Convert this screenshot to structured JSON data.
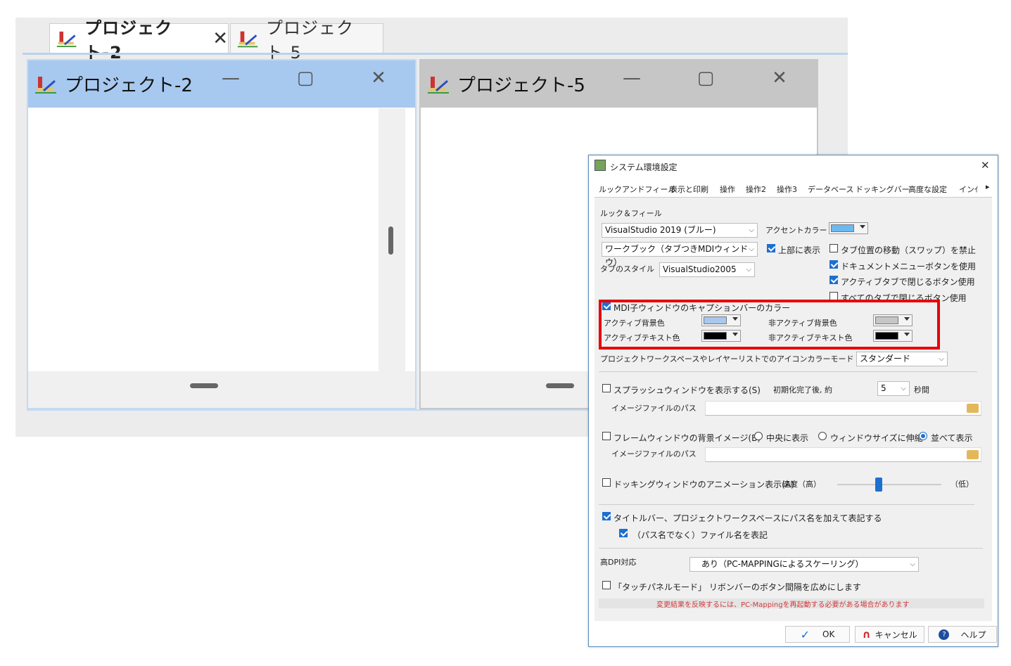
{
  "tabs": [
    {
      "label": "プロジェクト-2",
      "close": "✕"
    },
    {
      "label": "プロジェクト-5"
    }
  ],
  "windows": [
    {
      "title": "プロジェクト-2"
    },
    {
      "title": "プロジェクト-5"
    }
  ],
  "caption_buttons": {
    "minimize": "—",
    "maximize": "▢",
    "close": "✕"
  },
  "dialog": {
    "title": "システム環境設定",
    "close": "✕",
    "tabs": [
      "ルックアンドフィール",
      "表示と印刷",
      "操作",
      "操作2",
      "操作3",
      "データベース",
      "ドッキングバー",
      "高度な設定",
      "インｲ"
    ],
    "tab_scroll": "▸",
    "look": {
      "group_label": "ルック＆フィール",
      "theme": "VisualStudio 2019 (ブルー)",
      "workbook": "ワークブック（タブつきMDIウィンドウ）",
      "tab_style_label": "タブのスタイル",
      "tab_style": "VisualStudio2005",
      "accent_label": "アクセントカラー",
      "accent_color": "#6cb8f0",
      "top_show": "上部に表示",
      "no_tab_move": "タブ位置の移動（スワップ）を禁止",
      "doc_menu_btn": "ドキュメントメニューボタンを使用",
      "active_close_btn": "アクティブタブで閉じるボタン使用",
      "all_close_btn": "すべてのタブで閉じるボタン使用"
    },
    "mdi_caption": {
      "label": "MDI子ウィンドウのキャプションバーのカラー",
      "active_bg_label": "アクティブ背景色",
      "active_bg": "#a7c8ef",
      "active_text_label": "アクティブテキスト色",
      "active_text": "#000000",
      "inactive_bg_label": "非アクティブ背景色",
      "inactive_bg": "#c6c6c6",
      "inactive_text_label": "非アクティブテキスト色",
      "inactive_text": "#000000"
    },
    "icon_mode": {
      "label": "プロジェクトワークスペースやレイヤーリストでのアイコンカラーモード",
      "value": "スタンダード"
    },
    "splash": {
      "label": "スプラッシュウィンドウを表示する(S)",
      "init_label": "初期化完了後, 約",
      "seconds": "5",
      "seconds_unit": "秒間",
      "path_label": "イメージファイルのパス",
      "path": ""
    },
    "frame_bg": {
      "label": "フレームウィンドウの背景イメージ(B)",
      "center": "中央に表示",
      "stretch": "ウィンドウサイズに伸縮",
      "tile": "並べて表示",
      "path_label": "イメージファイルのパス",
      "path": ""
    },
    "dock_anim": {
      "label": "ドッキングウィンドウのアニメーション表示(A)",
      "speed_label": "速度（高）",
      "low_label": "（低）",
      "speed_level": 0.4
    },
    "title_path": {
      "label": "タイトルバー、プロジェクトワークスペースにパス名を加えて表記する",
      "filename_only": "（パス名でなく）ファイル名を表記"
    },
    "dpi": {
      "label": "高DPI対応",
      "value": "あり（PC-MAPPINGによるスケーリング）"
    },
    "touch": {
      "label": "「タッチパネルモード」 リボンバーのボタン間隔を広めにします"
    },
    "note": "変更結果を反映するには、PC-Mappingを再起動する必要がある場合があります",
    "buttons": {
      "ok": "OK",
      "cancel": "キャンセル",
      "help": "ヘルプ"
    }
  }
}
